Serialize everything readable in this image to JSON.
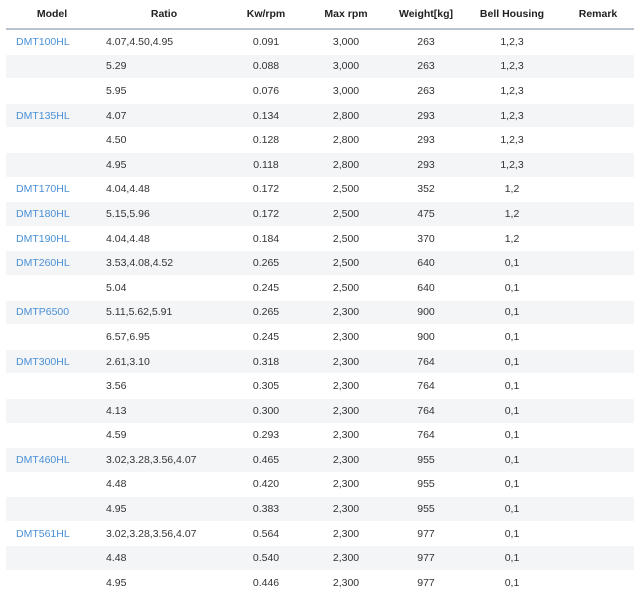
{
  "table": {
    "headers": [
      "Model",
      "Ratio",
      "Kw/rpm",
      "Max rpm",
      "Weight[kg]",
      "Bell Housing",
      "Remark"
    ],
    "rows": [
      {
        "model": "DMT100HL",
        "ratio": "4.07,4.50,4.95",
        "kw": "0.091",
        "max_rpm": "3,000",
        "weight": "263",
        "bell": "1,2,3",
        "remark": ""
      },
      {
        "model": "",
        "ratio": "5.29",
        "kw": "0.088",
        "max_rpm": "3,000",
        "weight": "263",
        "bell": "1,2,3",
        "remark": ""
      },
      {
        "model": "",
        "ratio": "5.95",
        "kw": "0.076",
        "max_rpm": "3,000",
        "weight": "263",
        "bell": "1,2,3",
        "remark": ""
      },
      {
        "model": "DMT135HL",
        "ratio": "4.07",
        "kw": "0.134",
        "max_rpm": "2,800",
        "weight": "293",
        "bell": "1,2,3",
        "remark": ""
      },
      {
        "model": "",
        "ratio": "4.50",
        "kw": "0.128",
        "max_rpm": "2,800",
        "weight": "293",
        "bell": "1,2,3",
        "remark": ""
      },
      {
        "model": "",
        "ratio": "4.95",
        "kw": "0.118",
        "max_rpm": "2,800",
        "weight": "293",
        "bell": "1,2,3",
        "remark": ""
      },
      {
        "model": "DMT170HL",
        "ratio": "4.04,4.48",
        "kw": "0.172",
        "max_rpm": "2,500",
        "weight": "352",
        "bell": "1,2",
        "remark": ""
      },
      {
        "model": "DMT180HL",
        "ratio": "5.15,5.96",
        "kw": "0.172",
        "max_rpm": "2,500",
        "weight": "475",
        "bell": "1,2",
        "remark": ""
      },
      {
        "model": "DMT190HL",
        "ratio": "4.04,4.48",
        "kw": "0.184",
        "max_rpm": "2,500",
        "weight": "370",
        "bell": "1,2",
        "remark": ""
      },
      {
        "model": "DMT260HL",
        "ratio": "3.53,4.08,4.52",
        "kw": "0.265",
        "max_rpm": "2,500",
        "weight": "640",
        "bell": "0,1",
        "remark": ""
      },
      {
        "model": "",
        "ratio": "5.04",
        "kw": "0.245",
        "max_rpm": "2,500",
        "weight": "640",
        "bell": "0,1",
        "remark": ""
      },
      {
        "model": "DMTP6500",
        "ratio": "5.11,5.62,5.91",
        "kw": "0.265",
        "max_rpm": "2,300",
        "weight": "900",
        "bell": "0,1",
        "remark": ""
      },
      {
        "model": "",
        "ratio": "6.57,6.95",
        "kw": "0.245",
        "max_rpm": "2,300",
        "weight": "900",
        "bell": "0,1",
        "remark": ""
      },
      {
        "model": "DMT300HL",
        "ratio": "2.61,3.10",
        "kw": "0.318",
        "max_rpm": "2,300",
        "weight": "764",
        "bell": "0,1",
        "remark": ""
      },
      {
        "model": "",
        "ratio": "3.56",
        "kw": "0.305",
        "max_rpm": "2,300",
        "weight": "764",
        "bell": "0,1",
        "remark": ""
      },
      {
        "model": "",
        "ratio": "4.13",
        "kw": "0.300",
        "max_rpm": "2,300",
        "weight": "764",
        "bell": "0,1",
        "remark": ""
      },
      {
        "model": "",
        "ratio": "4.59",
        "kw": "0.293",
        "max_rpm": "2,300",
        "weight": "764",
        "bell": "0,1",
        "remark": ""
      },
      {
        "model": "DMT460HL",
        "ratio": "3.02,3.28,3.56,4.07",
        "kw": "0.465",
        "max_rpm": "2,300",
        "weight": "955",
        "bell": "0,1",
        "remark": ""
      },
      {
        "model": "",
        "ratio": "4.48",
        "kw": "0.420",
        "max_rpm": "2,300",
        "weight": "955",
        "bell": "0,1",
        "remark": ""
      },
      {
        "model": "",
        "ratio": "4.95",
        "kw": "0.383",
        "max_rpm": "2,300",
        "weight": "955",
        "bell": "0,1",
        "remark": ""
      },
      {
        "model": "DMT561HL",
        "ratio": "3.02,3.28,3.56,4.07",
        "kw": "0.564",
        "max_rpm": "2,300",
        "weight": "977",
        "bell": "0,1",
        "remark": ""
      },
      {
        "model": "",
        "ratio": "4.48",
        "kw": "0.540",
        "max_rpm": "2,300",
        "weight": "977",
        "bell": "0,1",
        "remark": ""
      },
      {
        "model": "",
        "ratio": "4.95",
        "kw": "0.446",
        "max_rpm": "2,300",
        "weight": "977",
        "bell": "0,1",
        "remark": ""
      }
    ]
  },
  "colors": {
    "model_link": "#4a90d6",
    "header_rule": "#b9c3cd",
    "row_stripe": "#f3f5f7"
  }
}
